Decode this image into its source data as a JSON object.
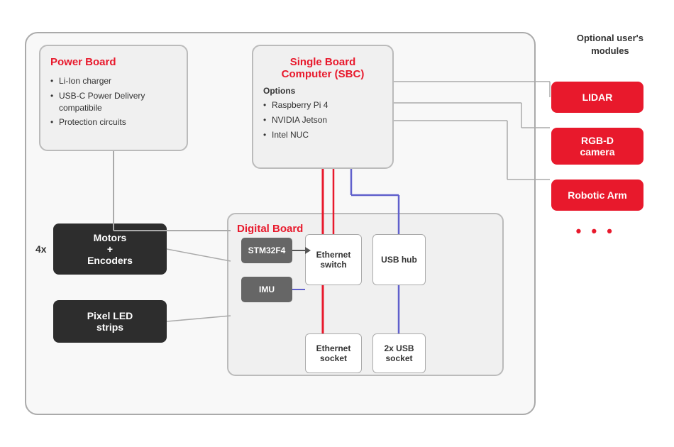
{
  "diagram": {
    "optional_modules_label": "Optional user's\nmodules",
    "modules": [
      {
        "id": "lidar",
        "label": "LIDAR"
      },
      {
        "id": "rgbd",
        "label": "RGB-D\ncamera"
      },
      {
        "id": "arm",
        "label": "Robotic Arm"
      }
    ],
    "dots": "• • •",
    "power_board": {
      "title": "Power Board",
      "bullets": [
        "Li-Ion charger",
        "USB-C Power Delivery compatibile",
        "Protection circuits"
      ]
    },
    "sbc_board": {
      "title": "Single Board Computer (SBC)",
      "options_label": "Options",
      "options": [
        "Raspberry Pi 4",
        "NVIDIA Jetson",
        "Intel NUC"
      ]
    },
    "digital_board": {
      "title": "Digital Board",
      "stm": "STM32F4",
      "imu": "IMU",
      "eth_switch": "Ethernet switch",
      "usb_hub": "USB hub",
      "eth_socket": "Ethernet socket",
      "usb_socket": "2x USB socket"
    },
    "motor_box": {
      "label": "Motors\n+\nEncoders"
    },
    "led_box": {
      "label": "Pixel LED\nstrips"
    },
    "label_4x": "4x"
  }
}
